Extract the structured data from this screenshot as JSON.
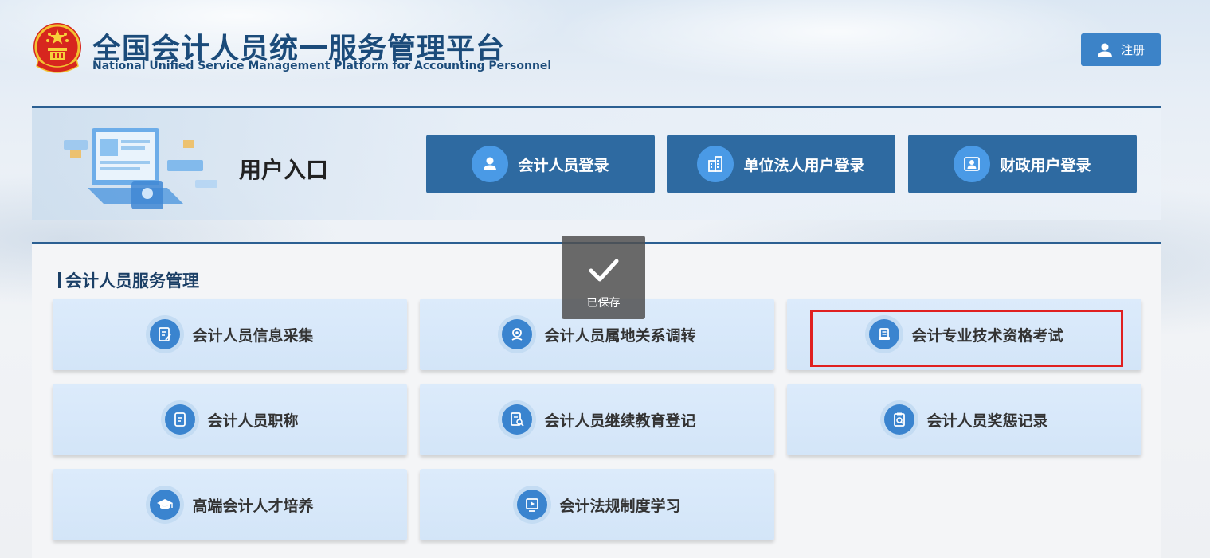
{
  "header": {
    "title_cn": "全国会计人员统一服务管理平台",
    "title_en": "National Unified Service Management Platform for Accounting Personnel",
    "register_label": "注册"
  },
  "entry": {
    "title": "用户入口",
    "buttons": [
      {
        "label": "会计人员登录",
        "icon": "person-icon"
      },
      {
        "label": "单位法人用户登录",
        "icon": "building-icon"
      },
      {
        "label": "财政用户登录",
        "icon": "screen-user-icon"
      }
    ]
  },
  "services": {
    "title": "会计人员服务管理",
    "items": [
      {
        "label": "会计人员信息采集",
        "icon": "form-edit-icon"
      },
      {
        "label": "会计人员属地关系调转",
        "icon": "location-icon"
      },
      {
        "label": "会计专业技术资格考试",
        "icon": "exam-icon"
      },
      {
        "label": "会计人员职称",
        "icon": "document-icon"
      },
      {
        "label": "会计人员继续教育登记",
        "icon": "doc-search-icon"
      },
      {
        "label": "会计人员奖惩记录",
        "icon": "record-search-icon"
      },
      {
        "label": "高端会计人才培养",
        "icon": "graduation-cap-icon"
      },
      {
        "label": "会计法规制度学习",
        "icon": "video-play-icon"
      }
    ]
  },
  "toast": {
    "text": "已保存",
    "icon": "checkmark-icon"
  },
  "colors": {
    "primary": "#2e6aa1",
    "accent": "#3c83c8",
    "highlight": "#e02020"
  }
}
